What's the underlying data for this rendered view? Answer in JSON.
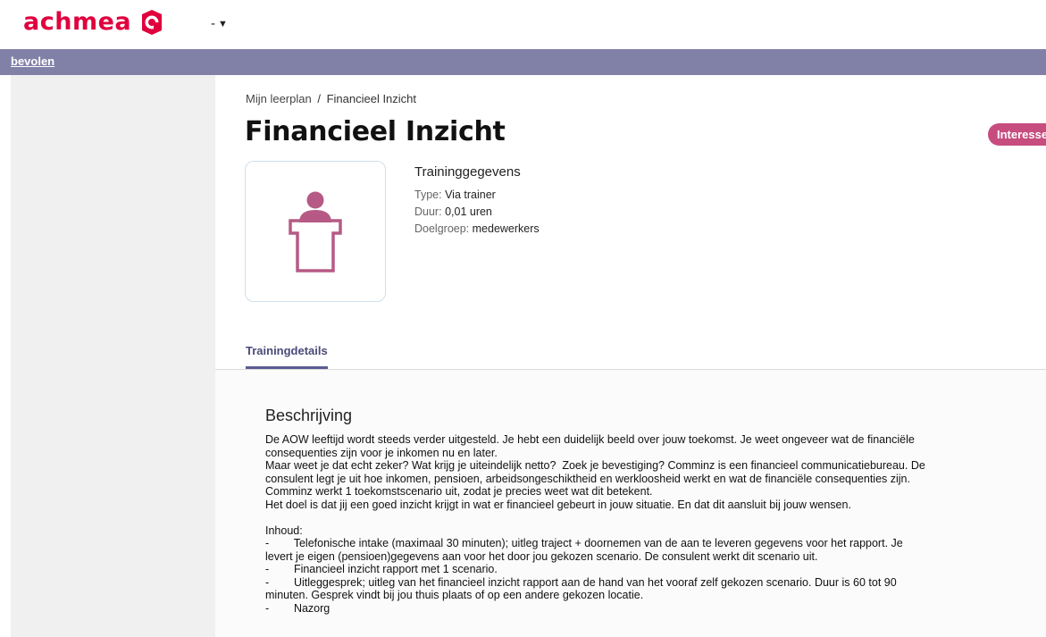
{
  "header": {
    "logo_text": "achmea",
    "language_value": "-",
    "brand_color": "#e0003d"
  },
  "nav": {
    "link_label": "bevolen",
    "band_color": "#8181a8"
  },
  "breadcrumb": {
    "parent": "Mijn leerplan",
    "separator": "/",
    "current": "Financieel Inzicht"
  },
  "page": {
    "title": "Financieel Inzicht",
    "interest_button": "Interesse",
    "interest_color": "#c74d7f",
    "image_icon": "trainer-podium-icon"
  },
  "training_info": {
    "heading": "Traininggegevens",
    "rows": [
      {
        "label": "Type:",
        "value": "Via trainer"
      },
      {
        "label": "Duur:",
        "value": "0,01 uren"
      },
      {
        "label": "Doelgroep:",
        "value": "medewerkers"
      }
    ]
  },
  "tabs": [
    {
      "label": "Trainingdetails",
      "active": true
    }
  ],
  "description": {
    "heading": "Beschrijving",
    "lines": [
      "De AOW leeftijd wordt steeds verder uitgesteld. Je hebt een duidelijk beeld over jouw toekomst. Je weet ongeveer wat de financiële",
      "consequenties zijn voor je inkomen nu en later.",
      "Maar weet je dat echt zeker? Wat krijg je uiteindelijk netto?  Zoek je bevestiging? Comminz is een financieel communicatiebureau. De",
      "consulent legt je uit hoe inkomen, pensioen, arbeidsongeschiktheid en werkloosheid werkt en wat de financiële consequenties zijn.",
      "Comminz werkt 1 toekomstscenario uit, zodat je precies weet wat dit betekent.",
      "Het doel is dat jij een goed inzicht krijgt in wat er financieel gebeurt in jouw situatie. En dat dit aansluit bij jouw wensen.",
      "",
      "Inhoud:",
      "-        Telefonische intake (maximaal 30 minuten); uitleg traject + doornemen van de aan te leveren gegevens voor het rapport. Je",
      "levert je eigen (pensioen)gegevens aan voor het door jou gekozen scenario. De consulent werkt dit scenario uit.",
      "-        Financieel inzicht rapport met 1 scenario.",
      "-        Uitleggesprek; uitleg van het financieel inzicht rapport aan de hand van het vooraf zelf gekozen scenario. Duur is 60 tot 90",
      "minuten. Gesprek vindt bij jou thuis plaats of op een andere gekozen locatie.",
      "-        Nazorg"
    ]
  }
}
